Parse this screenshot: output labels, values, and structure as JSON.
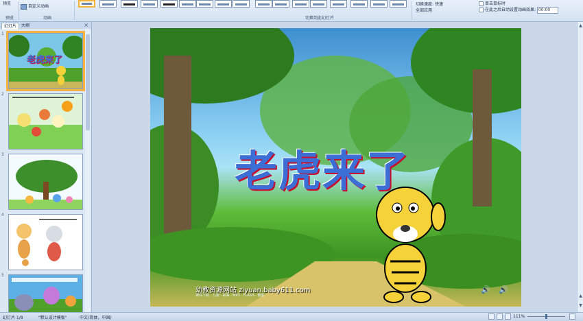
{
  "ribbon": {
    "preview_label": "预览",
    "custom_animation_label": "自定义动画",
    "preview_group": "预览",
    "animation_group": "动画",
    "transition_group": "切换到此幻灯片",
    "sound_label": "切换声音:",
    "sound_value": "[无声音]",
    "speed_label": "切换速度:",
    "speed_value": "快速",
    "apply_all_label": "全部应用",
    "advance_on_click": "单击鼠标时",
    "auto_after_label": "在此之后自动设置动画效果:",
    "auto_after_value": "00:00"
  },
  "panel": {
    "tab_slides": "幻灯片",
    "tab_outline": "大纲",
    "close_glyph": "×",
    "slides": [
      {
        "num": "1",
        "mini_title": "老虎来了"
      },
      {
        "num": "2"
      },
      {
        "num": "3"
      },
      {
        "num": "4"
      },
      {
        "num": "5"
      }
    ]
  },
  "slide": {
    "title": "老虎来了",
    "watermark": "幼教资源网站 ziyuan.baby611.com",
    "watermark_sub": "课件下载 · 儿歌 · 故事 · MP3 · FLASH · 教案",
    "speaker_glyph": "🔊"
  },
  "status": {
    "slide_info": "幻灯片 1/8",
    "theme": "\"默认设计模板\"",
    "language": "中文(简体，中国)",
    "zoom": "111%",
    "zoom_fraction": 0.5
  },
  "colors": {
    "title_blue": "#3b6fd6",
    "title_red": "#c8102e",
    "selection_orange": "#f5b142"
  }
}
